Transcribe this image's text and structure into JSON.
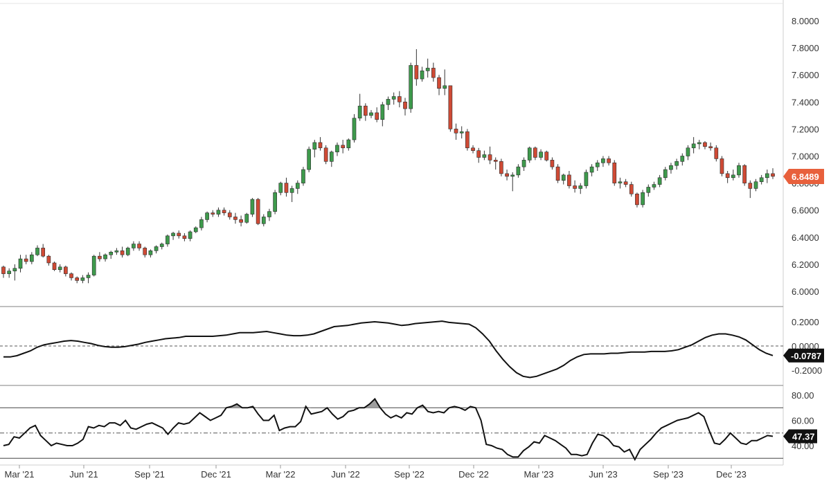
{
  "chart_data": [
    {
      "panel": "price",
      "type": "candlestick",
      "ylim": [
        6.0,
        8.0
      ],
      "y_ticks": [
        "8.0000",
        "7.8000",
        "7.6000",
        "7.4000",
        "7.2000",
        "7.0000",
        "6.8000",
        "6.6000",
        "6.4000",
        "6.2000",
        "6.0000"
      ],
      "last_value_label": "6.8489",
      "last_value": 6.8489,
      "colors": {
        "up": "#3e9a4c",
        "down": "#cf4a35",
        "wick": "#333333",
        "last_badge": "#e8603c"
      },
      "candles_ohlc": [
        [
          6.18,
          6.19,
          6.1,
          6.13
        ],
        [
          6.13,
          6.17,
          6.1,
          6.15
        ],
        [
          6.15,
          6.2,
          6.08,
          6.17
        ],
        [
          6.17,
          6.27,
          6.14,
          6.24
        ],
        [
          6.24,
          6.27,
          6.2,
          6.22
        ],
        [
          6.22,
          6.29,
          6.2,
          6.27
        ],
        [
          6.27,
          6.34,
          6.26,
          6.32
        ],
        [
          6.32,
          6.35,
          6.25,
          6.26
        ],
        [
          6.26,
          6.27,
          6.19,
          6.21
        ],
        [
          6.21,
          6.22,
          6.15,
          6.16
        ],
        [
          6.16,
          6.2,
          6.14,
          6.18
        ],
        [
          6.18,
          6.19,
          6.11,
          6.13
        ],
        [
          6.13,
          6.14,
          6.08,
          6.1
        ],
        [
          6.1,
          6.11,
          6.06,
          6.08
        ],
        [
          6.08,
          6.12,
          6.06,
          6.1
        ],
        [
          6.1,
          6.14,
          6.06,
          6.12
        ],
        [
          6.12,
          6.27,
          6.11,
          6.26
        ],
        [
          6.26,
          6.29,
          6.22,
          6.24
        ],
        [
          6.24,
          6.28,
          6.22,
          6.27
        ],
        [
          6.27,
          6.3,
          6.24,
          6.29
        ],
        [
          6.29,
          6.32,
          6.27,
          6.3
        ],
        [
          6.3,
          6.33,
          6.25,
          6.27
        ],
        [
          6.27,
          6.33,
          6.26,
          6.32
        ],
        [
          6.32,
          6.37,
          6.3,
          6.35
        ],
        [
          6.35,
          6.37,
          6.3,
          6.32
        ],
        [
          6.32,
          6.33,
          6.25,
          6.27
        ],
        [
          6.27,
          6.31,
          6.25,
          6.3
        ],
        [
          6.3,
          6.34,
          6.28,
          6.33
        ],
        [
          6.33,
          6.36,
          6.31,
          6.35
        ],
        [
          6.35,
          6.42,
          6.33,
          6.41
        ],
        [
          6.41,
          6.44,
          6.38,
          6.43
        ],
        [
          6.43,
          6.45,
          6.39,
          6.41
        ],
        [
          6.41,
          6.43,
          6.37,
          6.39
        ],
        [
          6.39,
          6.45,
          6.37,
          6.44
        ],
        [
          6.44,
          6.48,
          6.43,
          6.47
        ],
        [
          6.47,
          6.55,
          6.45,
          6.53
        ],
        [
          6.53,
          6.59,
          6.51,
          6.58
        ],
        [
          6.58,
          6.6,
          6.55,
          6.57
        ],
        [
          6.57,
          6.62,
          6.55,
          6.6
        ],
        [
          6.6,
          6.62,
          6.56,
          6.58
        ],
        [
          6.58,
          6.6,
          6.53,
          6.55
        ],
        [
          6.55,
          6.58,
          6.5,
          6.53
        ],
        [
          6.53,
          6.56,
          6.48,
          6.51
        ],
        [
          6.51,
          6.58,
          6.5,
          6.57
        ],
        [
          6.57,
          6.69,
          6.55,
          6.68
        ],
        [
          6.68,
          6.69,
          6.49,
          6.5
        ],
        [
          6.5,
          6.57,
          6.48,
          6.55
        ],
        [
          6.55,
          6.61,
          6.52,
          6.59
        ],
        [
          6.59,
          6.75,
          6.57,
          6.73
        ],
        [
          6.73,
          6.81,
          6.71,
          6.8
        ],
        [
          6.8,
          6.84,
          6.7,
          6.73
        ],
        [
          6.73,
          6.78,
          6.66,
          6.76
        ],
        [
          6.76,
          6.82,
          6.72,
          6.8
        ],
        [
          6.8,
          6.92,
          6.78,
          6.9
        ],
        [
          6.9,
          7.07,
          6.88,
          7.05
        ],
        [
          7.05,
          7.12,
          6.99,
          7.1
        ],
        [
          7.1,
          7.14,
          7.04,
          7.06
        ],
        [
          7.06,
          7.08,
          6.94,
          6.96
        ],
        [
          6.96,
          7.04,
          6.92,
          7.03
        ],
        [
          7.03,
          7.1,
          7.0,
          7.08
        ],
        [
          7.08,
          7.12,
          7.02,
          7.06
        ],
        [
          7.06,
          7.13,
          7.04,
          7.12
        ],
        [
          7.12,
          7.31,
          7.1,
          7.28
        ],
        [
          7.28,
          7.46,
          7.26,
          7.37
        ],
        [
          7.37,
          7.39,
          7.26,
          7.3
        ],
        [
          7.3,
          7.34,
          7.28,
          7.32
        ],
        [
          7.32,
          7.36,
          7.25,
          7.27
        ],
        [
          7.27,
          7.4,
          7.22,
          7.38
        ],
        [
          7.38,
          7.44,
          7.34,
          7.42
        ],
        [
          7.42,
          7.47,
          7.38,
          7.44
        ],
        [
          7.44,
          7.48,
          7.36,
          7.4
        ],
        [
          7.4,
          7.43,
          7.3,
          7.35
        ],
        [
          7.35,
          7.69,
          7.32,
          7.67
        ],
        [
          7.67,
          7.79,
          7.52,
          7.57
        ],
        [
          7.57,
          7.66,
          7.55,
          7.63
        ],
        [
          7.63,
          7.72,
          7.58,
          7.65
        ],
        [
          7.65,
          7.69,
          7.55,
          7.58
        ],
        [
          7.58,
          7.6,
          7.45,
          7.5
        ],
        [
          7.5,
          7.64,
          7.45,
          7.52
        ],
        [
          7.52,
          7.52,
          7.18,
          7.2
        ],
        [
          7.2,
          7.24,
          7.12,
          7.17
        ],
        [
          7.17,
          7.22,
          7.13,
          7.18
        ],
        [
          7.18,
          7.2,
          7.04,
          7.06
        ],
        [
          7.06,
          7.08,
          7.02,
          7.04
        ],
        [
          7.04,
          7.06,
          6.95,
          6.99
        ],
        [
          6.99,
          7.04,
          6.97,
          7.01
        ],
        [
          7.01,
          7.07,
          6.94,
          6.97
        ],
        [
          6.97,
          6.99,
          6.9,
          6.96
        ],
        [
          6.96,
          6.98,
          6.85,
          6.87
        ],
        [
          6.87,
          6.9,
          6.82,
          6.85
        ],
        [
          6.85,
          6.88,
          6.74,
          6.86
        ],
        [
          6.86,
          6.94,
          6.84,
          6.92
        ],
        [
          6.92,
          6.99,
          6.89,
          6.97
        ],
        [
          6.97,
          7.07,
          6.95,
          7.06
        ],
        [
          7.06,
          7.07,
          6.97,
          6.99
        ],
        [
          6.99,
          7.05,
          6.97,
          7.03
        ],
        [
          7.03,
          7.04,
          6.96,
          6.97
        ],
        [
          6.97,
          6.99,
          6.9,
          6.92
        ],
        [
          6.92,
          6.94,
          6.8,
          6.82
        ],
        [
          6.82,
          6.87,
          6.79,
          6.86
        ],
        [
          6.86,
          6.89,
          6.76,
          6.78
        ],
        [
          6.78,
          6.82,
          6.73,
          6.76
        ],
        [
          6.76,
          6.8,
          6.72,
          6.78
        ],
        [
          6.78,
          6.9,
          6.76,
          6.88
        ],
        [
          6.88,
          6.94,
          6.85,
          6.92
        ],
        [
          6.92,
          6.97,
          6.89,
          6.95
        ],
        [
          6.95,
          7.0,
          6.92,
          6.98
        ],
        [
          6.98,
          7.0,
          6.93,
          6.95
        ],
        [
          6.95,
          6.97,
          6.78,
          6.8
        ],
        [
          6.8,
          6.84,
          6.76,
          6.81
        ],
        [
          6.81,
          6.83,
          6.77,
          6.79
        ],
        [
          6.79,
          6.81,
          6.7,
          6.72
        ],
        [
          6.72,
          6.73,
          6.62,
          6.64
        ],
        [
          6.64,
          6.75,
          6.62,
          6.73
        ],
        [
          6.73,
          6.79,
          6.7,
          6.77
        ],
        [
          6.77,
          6.81,
          6.75,
          6.79
        ],
        [
          6.79,
          6.86,
          6.77,
          6.84
        ],
        [
          6.84,
          6.92,
          6.82,
          6.9
        ],
        [
          6.9,
          6.95,
          6.87,
          6.93
        ],
        [
          6.93,
          6.98,
          6.9,
          6.96
        ],
        [
          6.96,
          7.02,
          6.93,
          7.0
        ],
        [
          7.0,
          7.08,
          6.97,
          7.06
        ],
        [
          7.06,
          7.14,
          7.02,
          7.09
        ],
        [
          7.09,
          7.12,
          7.05,
          7.1
        ],
        [
          7.1,
          7.11,
          7.05,
          7.07
        ],
        [
          7.07,
          7.1,
          7.04,
          7.06
        ],
        [
          7.06,
          7.08,
          6.96,
          6.98
        ],
        [
          6.98,
          7.0,
          6.85,
          6.87
        ],
        [
          6.87,
          6.89,
          6.8,
          6.84
        ],
        [
          6.84,
          6.9,
          6.82,
          6.86
        ],
        [
          6.86,
          6.95,
          6.84,
          6.93
        ],
        [
          6.93,
          6.94,
          6.78,
          6.8
        ],
        [
          6.8,
          6.82,
          6.69,
          6.76
        ],
        [
          6.76,
          6.83,
          6.74,
          6.81
        ],
        [
          6.81,
          6.86,
          6.79,
          6.84
        ],
        [
          6.84,
          6.9,
          6.8,
          6.87
        ],
        [
          6.87,
          6.91,
          6.83,
          6.85
        ]
      ],
      "x_tick_labels": [
        "Mar '21",
        "Jun '21",
        "Sep '21",
        "Dec '21",
        "Mar '22",
        "Jun '22",
        "Sep '22",
        "Dec '22",
        "Mar '23",
        "Jun '23",
        "Sep '23",
        "Dec '23"
      ]
    },
    {
      "panel": "oscillator",
      "type": "line",
      "ylim": [
        -0.3,
        0.3
      ],
      "y_ticks": [
        "0.2000",
        "0.0000",
        "-0.2000"
      ],
      "zero_line": 0.0,
      "last_value_label": "-0.0787",
      "values": [
        -0.09,
        -0.09,
        -0.08,
        -0.06,
        -0.04,
        -0.01,
        0.01,
        0.02,
        0.03,
        0.04,
        0.045,
        0.04,
        0.03,
        0.02,
        0.005,
        -0.005,
        -0.01,
        -0.01,
        -0.005,
        0.005,
        0.015,
        0.03,
        0.04,
        0.05,
        0.06,
        0.065,
        0.07,
        0.08,
        0.08,
        0.08,
        0.08,
        0.08,
        0.085,
        0.09,
        0.1,
        0.11,
        0.11,
        0.11,
        0.115,
        0.12,
        0.11,
        0.1,
        0.09,
        0.085,
        0.085,
        0.09,
        0.1,
        0.12,
        0.14,
        0.16,
        0.165,
        0.17,
        0.18,
        0.19,
        0.195,
        0.2,
        0.195,
        0.19,
        0.18,
        0.17,
        0.175,
        0.185,
        0.19,
        0.195,
        0.2,
        0.205,
        0.195,
        0.19,
        0.185,
        0.18,
        0.15,
        0.1,
        0.04,
        -0.04,
        -0.11,
        -0.17,
        -0.22,
        -0.25,
        -0.26,
        -0.25,
        -0.23,
        -0.21,
        -0.19,
        -0.16,
        -0.12,
        -0.09,
        -0.07,
        -0.065,
        -0.065,
        -0.065,
        -0.06,
        -0.06,
        -0.055,
        -0.05,
        -0.05,
        -0.05,
        -0.045,
        -0.045,
        -0.045,
        -0.04,
        -0.03,
        -0.01,
        0.01,
        0.04,
        0.07,
        0.09,
        0.1,
        0.1,
        0.09,
        0.075,
        0.05,
        0.01,
        -0.03,
        -0.06,
        -0.0787
      ]
    },
    {
      "panel": "rsi",
      "type": "line",
      "ylim": [
        25,
        85
      ],
      "y_ticks": [
        "80.00",
        "60.00",
        "40.00"
      ],
      "upper_band": 70,
      "lower_band": 30,
      "mid_line": 50,
      "last_value_label": "47.37",
      "values": [
        40,
        41,
        47,
        46,
        50,
        54,
        56,
        48,
        44,
        40,
        42,
        41,
        40,
        40,
        42,
        45,
        55,
        54,
        56,
        55,
        58,
        58,
        56,
        60,
        54,
        53,
        55,
        57,
        58,
        56,
        54,
        49,
        54,
        58,
        57,
        58,
        62,
        66,
        63,
        60,
        62,
        64,
        70,
        71,
        73,
        70,
        70,
        71,
        65,
        60,
        60,
        64,
        52,
        54,
        55,
        55,
        59,
        71,
        65,
        66,
        67,
        70,
        65,
        61,
        63,
        67,
        68,
        70,
        70,
        73,
        77,
        70,
        65,
        62,
        64,
        62,
        66,
        65,
        70,
        72,
        67,
        66,
        67,
        66,
        70,
        71,
        70,
        68,
        71,
        70,
        60,
        41,
        40,
        38,
        37,
        33,
        31,
        31,
        36,
        39,
        43,
        42,
        48,
        46,
        44,
        41,
        38,
        33,
        33,
        32,
        33,
        42,
        49,
        48,
        45,
        40,
        39,
        35,
        37,
        29,
        37,
        41,
        45,
        50,
        54,
        56,
        58,
        60,
        61,
        62,
        64,
        66,
        63,
        52,
        42,
        41,
        45,
        50,
        46,
        42,
        41,
        44,
        44,
        46,
        48,
        47.37
      ]
    }
  ]
}
